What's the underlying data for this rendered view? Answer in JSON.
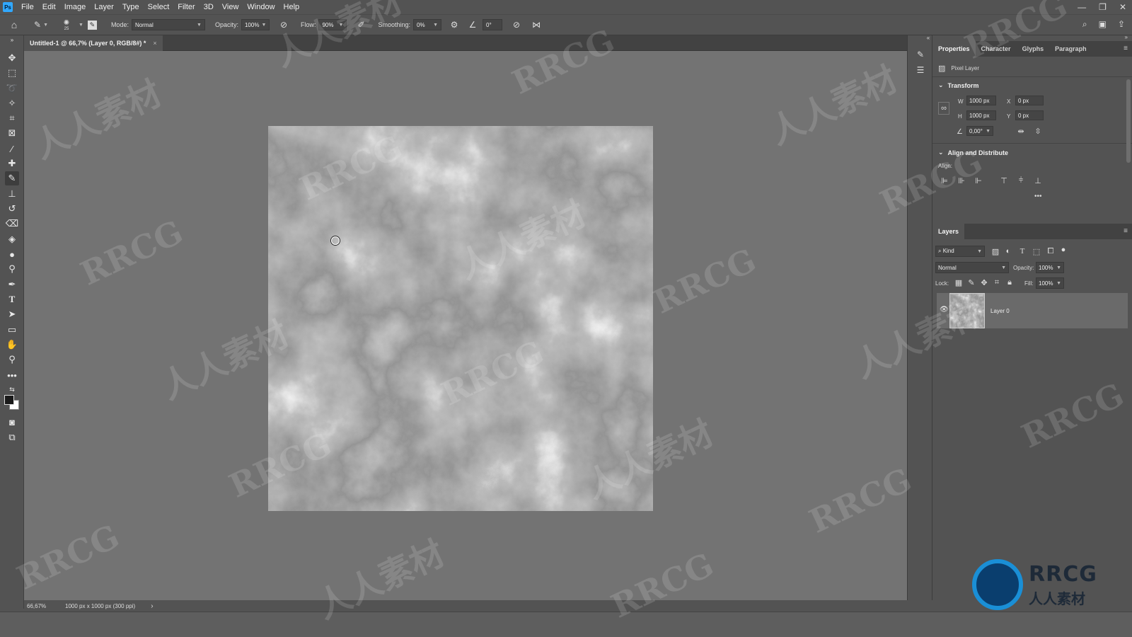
{
  "menubar": {
    "app_logo": "Ps",
    "items": [
      "File",
      "Edit",
      "Image",
      "Layer",
      "Type",
      "Select",
      "Filter",
      "3D",
      "View",
      "Window",
      "Help"
    ]
  },
  "options_bar": {
    "brush_size": "25",
    "mode_label": "Mode:",
    "mode_value": "Normal",
    "opacity_label": "Opacity:",
    "opacity_value": "100%",
    "flow_label": "Flow:",
    "flow_value": "90%",
    "smoothing_label": "Smoothing:",
    "smoothing_value": "0%",
    "angle_value": "0°"
  },
  "document": {
    "tab_title": "Untitled-1 @ 66,7% (Layer 0, RGB/8#) *",
    "zoom": "66,67%",
    "doc_info": "1000 px x 1000 px (300 ppi)"
  },
  "properties_panel": {
    "tabs": [
      "Properties",
      "Character",
      "Glyphs",
      "Paragraph"
    ],
    "layer_type": "Pixel Layer",
    "transform_title": "Transform",
    "w_label": "W",
    "w_value": "1000 px",
    "h_label": "H",
    "h_value": "1000 px",
    "x_label": "X",
    "x_value": "0 px",
    "y_label": "Y",
    "y_value": "0 px",
    "angle_value": "0,00°",
    "align_title": "Align and Distribute",
    "align_label": "Align:",
    "more": "•••"
  },
  "layers_panel": {
    "title": "Layers",
    "filter_kind": "Kind",
    "blend_mode": "Normal",
    "opacity_label": "Opacity:",
    "opacity_value": "100%",
    "lock_label": "Lock:",
    "fill_label": "Fill:",
    "fill_value": "100%",
    "layers": [
      {
        "name": "Layer 0",
        "visible": true
      }
    ]
  },
  "watermark": {
    "latin": "RRCG",
    "cjk": "人人素材"
  },
  "logo": {
    "text": "RRCG",
    "sub": "人人素材"
  },
  "colors": {
    "ui_bg": "#535353",
    "workspace": "#737373",
    "accent_blue": "#31a8ff"
  }
}
